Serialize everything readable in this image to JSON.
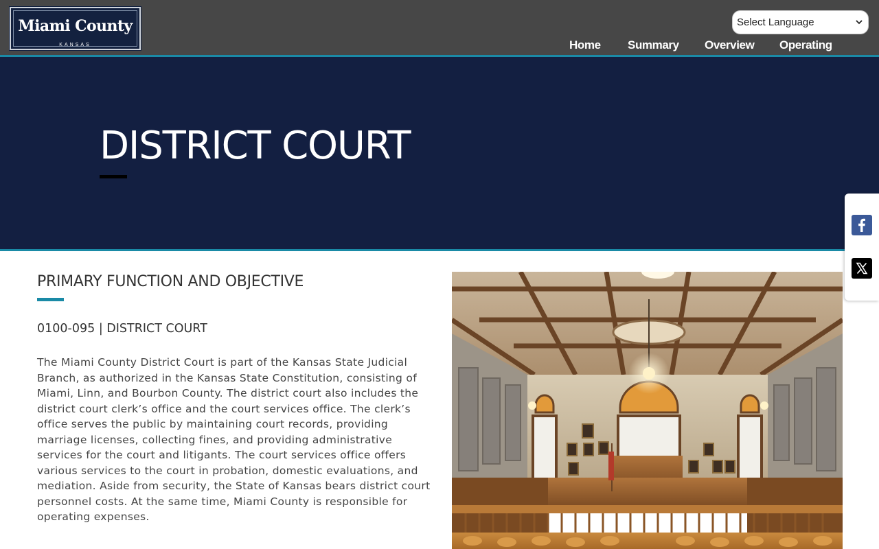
{
  "header": {
    "logo": {
      "title": "Miami County",
      "subtitle": "KANSAS"
    },
    "language_select": {
      "value": "Select Language"
    },
    "nav": [
      {
        "label": "Home"
      },
      {
        "label": "Summary"
      },
      {
        "label": "Overview"
      },
      {
        "label": "Operating"
      }
    ]
  },
  "hero": {
    "title": "DISTRICT COURT"
  },
  "social": {
    "icons": [
      "facebook-icon",
      "x-twitter-icon"
    ]
  },
  "content": {
    "section_title": "PRIMARY FUNCTION AND OBJECTIVE",
    "code": "0100-095 | DISTRICT COURT",
    "body": "The Miami County District Court is part of the Kansas State Judicial Branch, as authorized in the Kansas State Constitution, consisting of Miami, Linn, and Bourbon County. The district court also includes the district court clerk’s office and the court services office. The clerk’s office serves the public by maintaining court records, providing marriage licenses, collecting fines, and providing administrative services for the court and litigants. The court services office offers various services to the court in probation, domestic evaluations, and mediation. Aside from security, the State of Kansas bears district court personnel costs. At the same time, Miami County is responsible for operating expenses."
  },
  "colors": {
    "header_bg": "#474747",
    "hero_bg": "#131f41",
    "accent": "#1a8aa6",
    "facebook": "#3b5998"
  }
}
